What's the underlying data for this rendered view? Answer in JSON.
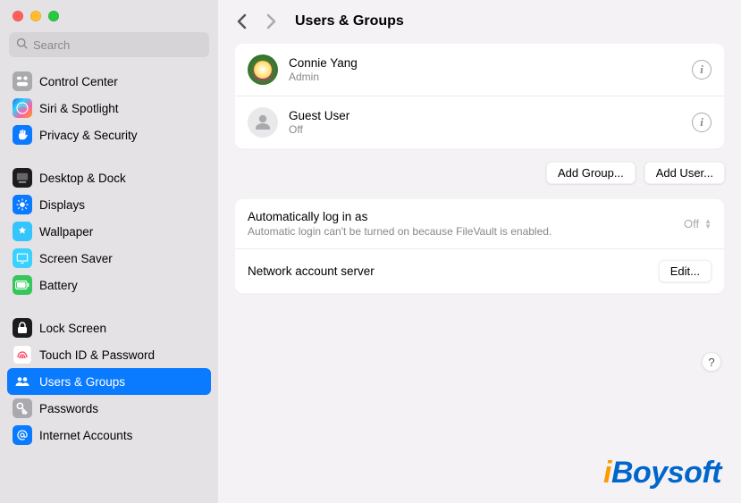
{
  "search": {
    "placeholder": "Search"
  },
  "header": {
    "title": "Users & Groups"
  },
  "sidebar": [
    {
      "items": [
        {
          "id": "control-center",
          "label": "Control Center",
          "iconBg": "#a9a9ae",
          "glyph": "cc"
        },
        {
          "id": "siri-spotlight",
          "label": "Siri & Spotlight",
          "iconBg": "linear-gradient(135deg,#1a73e8,#34d0ff,#ff5fa2,#ff9f1a)",
          "glyph": "siri"
        },
        {
          "id": "privacy-security",
          "label": "Privacy & Security",
          "iconBg": "#0a7aff",
          "glyph": "hand"
        }
      ]
    },
    {
      "items": [
        {
          "id": "desktop-dock",
          "label": "Desktop & Dock",
          "iconBg": "#1c1c1e",
          "glyph": "dock"
        },
        {
          "id": "displays",
          "label": "Displays",
          "iconBg": "#0a7aff",
          "glyph": "displays"
        },
        {
          "id": "wallpaper",
          "label": "Wallpaper",
          "iconBg": "#34c5ff",
          "glyph": "wallpaper"
        },
        {
          "id": "screen-saver",
          "label": "Screen Saver",
          "iconBg": "#3ad1ff",
          "glyph": "screensaver"
        },
        {
          "id": "battery",
          "label": "Battery",
          "iconBg": "#34c759",
          "glyph": "battery"
        }
      ]
    },
    {
      "items": [
        {
          "id": "lock-screen",
          "label": "Lock Screen",
          "iconBg": "#1c1c1e",
          "glyph": "lock"
        },
        {
          "id": "touch-id",
          "label": "Touch ID & Password",
          "iconBg": "#ffffff",
          "glyph": "touchid"
        },
        {
          "id": "users-groups",
          "label": "Users & Groups",
          "iconBg": "#0a7aff",
          "glyph": "users",
          "selected": true
        },
        {
          "id": "passwords",
          "label": "Passwords",
          "iconBg": "#a9a9ae",
          "glyph": "key"
        },
        {
          "id": "internet-accounts",
          "label": "Internet Accounts",
          "iconBg": "#0a7aff",
          "glyph": "at"
        }
      ]
    }
  ],
  "users": [
    {
      "name": "Connie Yang",
      "sub": "Admin",
      "avatar": "pic"
    },
    {
      "name": "Guest User",
      "sub": "Off",
      "avatar": "guest"
    }
  ],
  "buttons": {
    "addGroup": "Add Group...",
    "addUser": "Add User...",
    "edit": "Edit..."
  },
  "settings": {
    "autoLogin": {
      "label": "Automatically log in as",
      "sub": "Automatic login can't be turned on because FileVault is enabled.",
      "value": "Off"
    },
    "network": {
      "label": "Network account server"
    }
  },
  "watermark": "Boysoft",
  "help": "?"
}
